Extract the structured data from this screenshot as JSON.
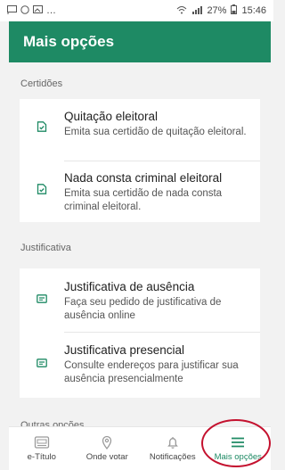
{
  "status_bar": {
    "percent": "27%",
    "time": "15:46",
    "left_glyph": "…"
  },
  "app_bar": {
    "title": "Mais opções"
  },
  "sections": {
    "certidoes": {
      "title": "Certidões",
      "items": [
        {
          "title": "Quitação eleitoral",
          "desc": "Emita sua certidão de quitação eleitoral."
        },
        {
          "title": "Nada consta criminal eleitoral",
          "desc": "Emita sua certidão de nada consta criminal eleitoral."
        }
      ]
    },
    "justificativa": {
      "title": "Justificativa",
      "items": [
        {
          "title": "Justificativa de ausência",
          "desc": "Faça seu pedido de justificativa de ausência online"
        },
        {
          "title": "Justificativa presencial",
          "desc": "Consulte endereços para justificar sua ausência presencialmente"
        }
      ]
    },
    "outras": {
      "title": "Outras opções"
    }
  },
  "bottom_nav": {
    "tabs": [
      {
        "label": "e-Título",
        "icon": "id-card-icon"
      },
      {
        "label": "Onde votar",
        "icon": "location-pin-icon"
      },
      {
        "label": "Notificações",
        "icon": "bell-icon"
      },
      {
        "label": "Mais opções",
        "icon": "hamburger-menu-icon"
      }
    ]
  },
  "colors": {
    "brand_green": "#1e8a64",
    "highlight_red": "#c4122f"
  }
}
